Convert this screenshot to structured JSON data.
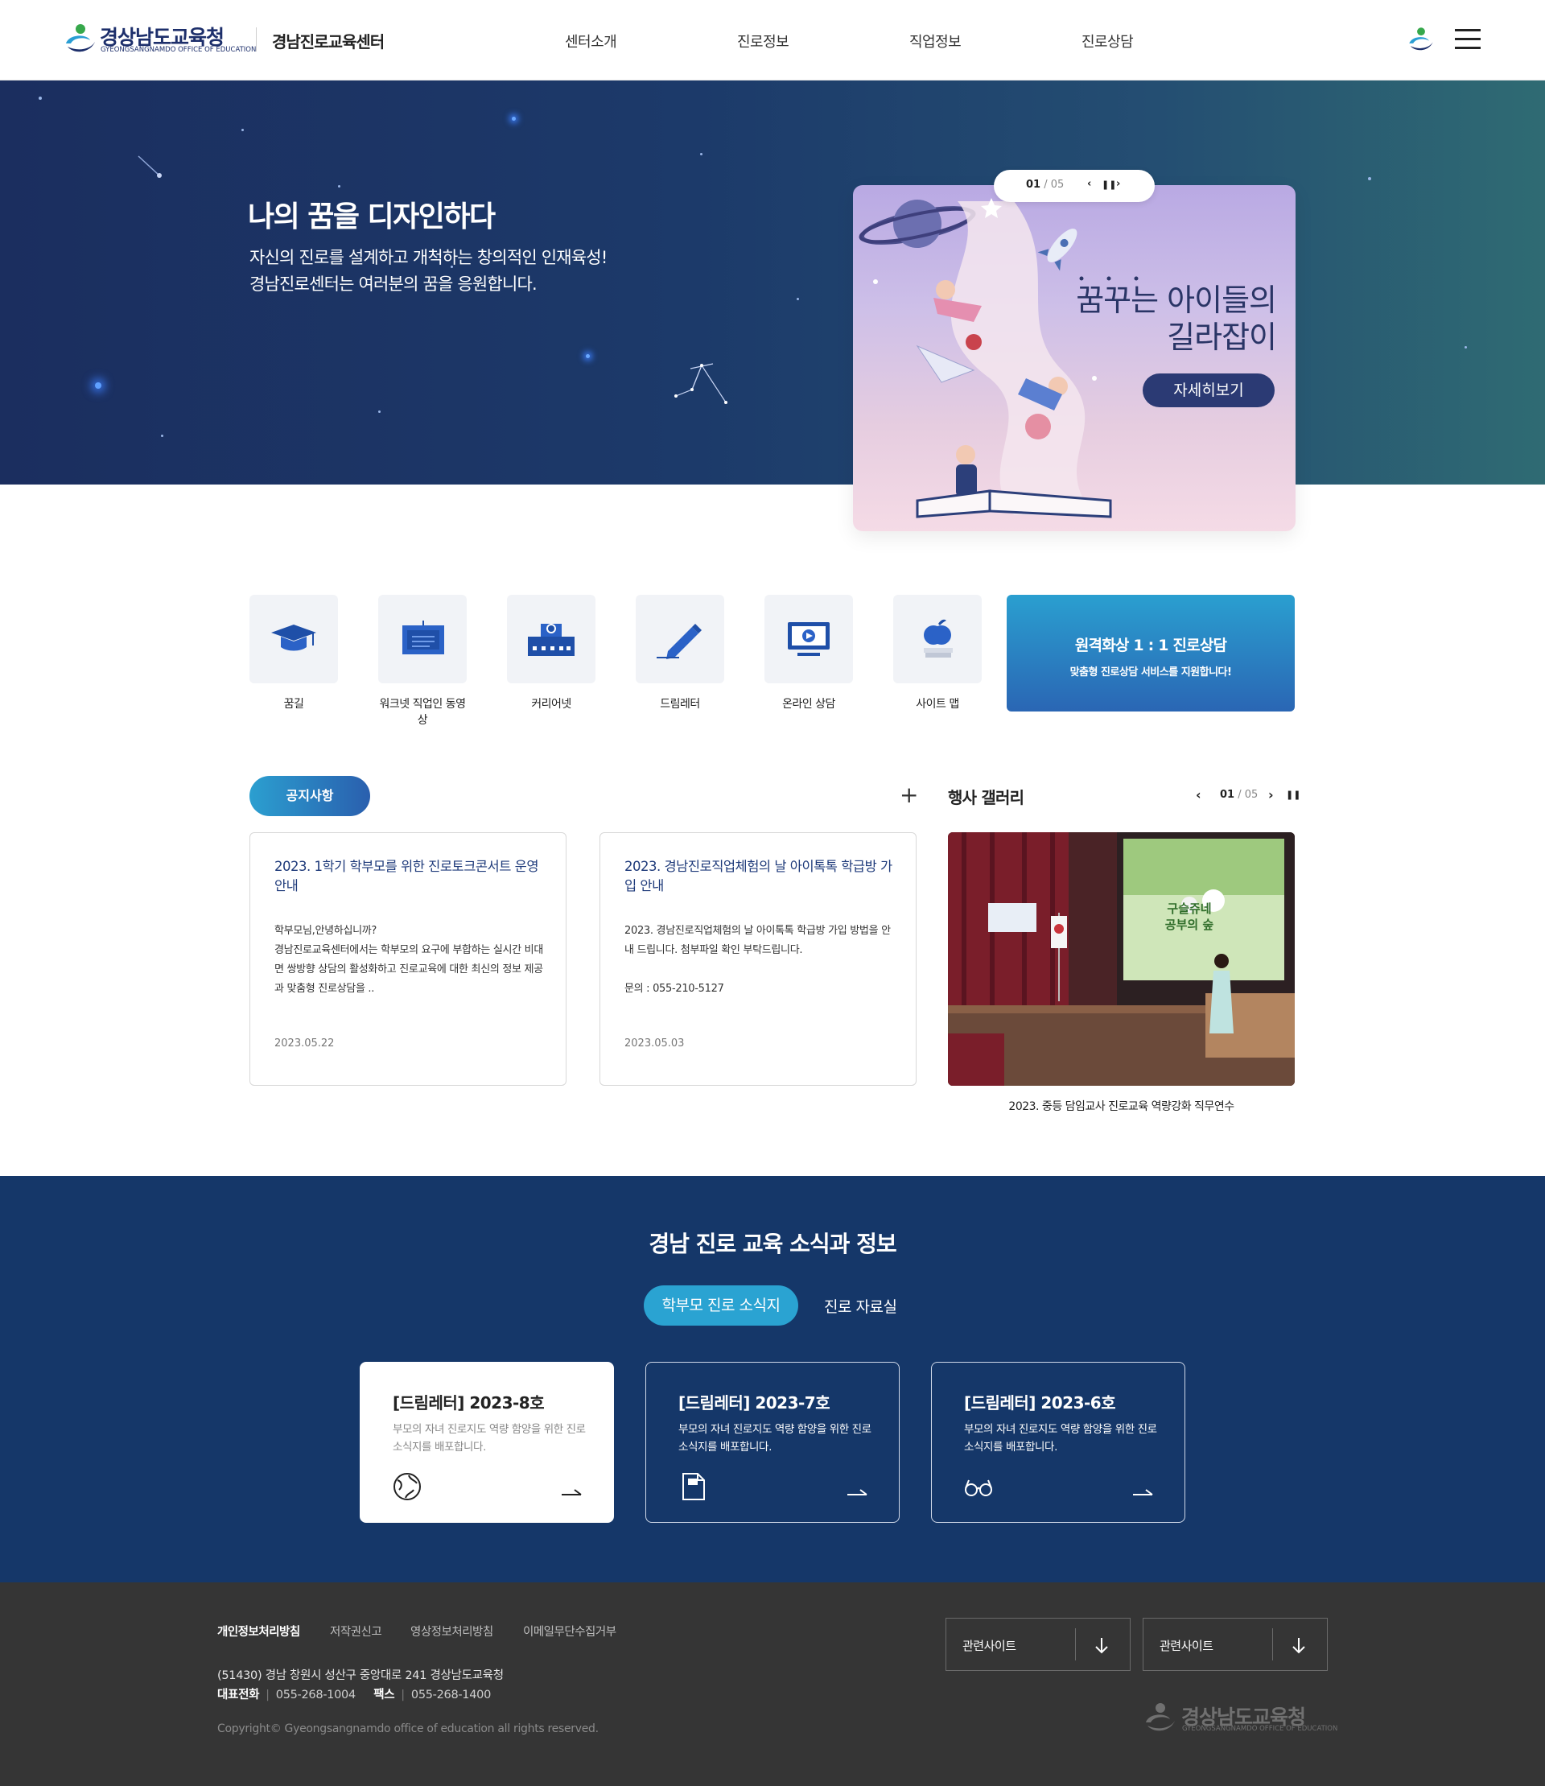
{
  "header": {
    "logo_ko": "경상남도교육청",
    "logo_en": "GYEONGSANGNAMDO OFFICE OF EDUCATION",
    "center_name": "경남진로교육센터",
    "nav": [
      "센터소개",
      "진로정보",
      "직업정보",
      "진로상담"
    ]
  },
  "hero": {
    "title": "나의 꿈을 디자인하다",
    "subtitle_line1": "자신의 진로를 설계하고 개척하는 창의적인 인재육성!",
    "subtitle_line2": "경남진로센터는 여러분의 꿈을 응원합니다.",
    "slider_current": "01",
    "slider_total": "/ 05",
    "banner_line1": "꿈꾸는 아이들의",
    "banner_line2": "길라잡이",
    "banner_button": "자세히보기"
  },
  "quick_menu": [
    {
      "label": "꿈길",
      "icon": "graduation-cap-icon"
    },
    {
      "label": "워크넷 직업인 동영상",
      "icon": "blackboard-icon"
    },
    {
      "label": "커리어넷",
      "icon": "school-building-icon"
    },
    {
      "label": "드림레터",
      "icon": "pencil-icon"
    },
    {
      "label": "온라인 상담",
      "icon": "monitor-play-icon"
    },
    {
      "label": "사이트 맵",
      "icon": "apple-books-icon"
    }
  ],
  "remote": {
    "title": "원격화상 1 : 1 진로상담",
    "subtitle": "맞춤형 진로상담 서비스를 지원합니다!"
  },
  "notice": {
    "tab": "공지사항",
    "more": "+",
    "items": [
      {
        "title": "2023. 1학기 학부모를 위한 진로토크콘서트 운영 안내",
        "body": "학부모님,안녕하십니까?\n경남진로교육센터에서는 학부모의 요구에 부합하는 실시간 비대면 쌍방향 상담의 활성화하고 진로교육에 대한 최신의 정보 제공과 맞춤형 진로상담을 ..",
        "date": "2023.05.22"
      },
      {
        "title": "2023. 경남진로직업체험의 날 아이톡톡 학급방 가입 안내",
        "body": "2023. 경남진로직업체험의 날 아이톡톡 학급방 가입 방법을 안내 드립니다. 첨부파일 확인 부탁드립니다.\n\n문의 : 055-210-5127",
        "date": "2023.05.03"
      }
    ]
  },
  "gallery": {
    "title": "행사 갤러리",
    "current": "01",
    "total": "/ 05",
    "screen_text1": "구슬쥬네",
    "screen_text2": "공부의 숲",
    "caption": "2023. 중등 담임교사 진로교육 역량강화 직무연수"
  },
  "news": {
    "title": "경남 진로 교육 소식과 정보",
    "tabs": [
      "학부모 진로 소식지",
      "진로 자료실"
    ],
    "cards": [
      {
        "title": "[드림레터] 2023-8호",
        "desc": "부모의 자녀 진로지도 역량 함양을 위한 진로소식지를 배포합니다.",
        "icon": "globe-icon"
      },
      {
        "title": "[드림레터] 2023-7호",
        "desc": "부모의 자녀 진로지도 역량 함양을 위한 진로소식지를 배포합니다.",
        "icon": "document-icon"
      },
      {
        "title": "[드림레터] 2023-6호",
        "desc": "부모의 자녀 진로지도 역량 함양을 위한 진로소식지를 배포합니다.",
        "icon": "glasses-icon"
      }
    ]
  },
  "footer": {
    "links": [
      "개인정보처리방침",
      "저작권신고",
      "영상정보처리방침",
      "이메일무단수집거부"
    ],
    "address": "(51430) 경남 창원시 성산구 중앙대로 241 경상남도교육청",
    "phone_label": "대표전화",
    "phone": "055-268-1004",
    "fax_label": "팩스",
    "fax": "055-268-1400",
    "copyright": "Copyright© Gyeongsangnamdo office of education all rights reserved.",
    "related1": "관련사이트",
    "related2": "관련사이트",
    "logo_ko": "경상남도교육청",
    "logo_en": "GYEONGSANGNAMDO OFFICE OF EDUCATION"
  }
}
